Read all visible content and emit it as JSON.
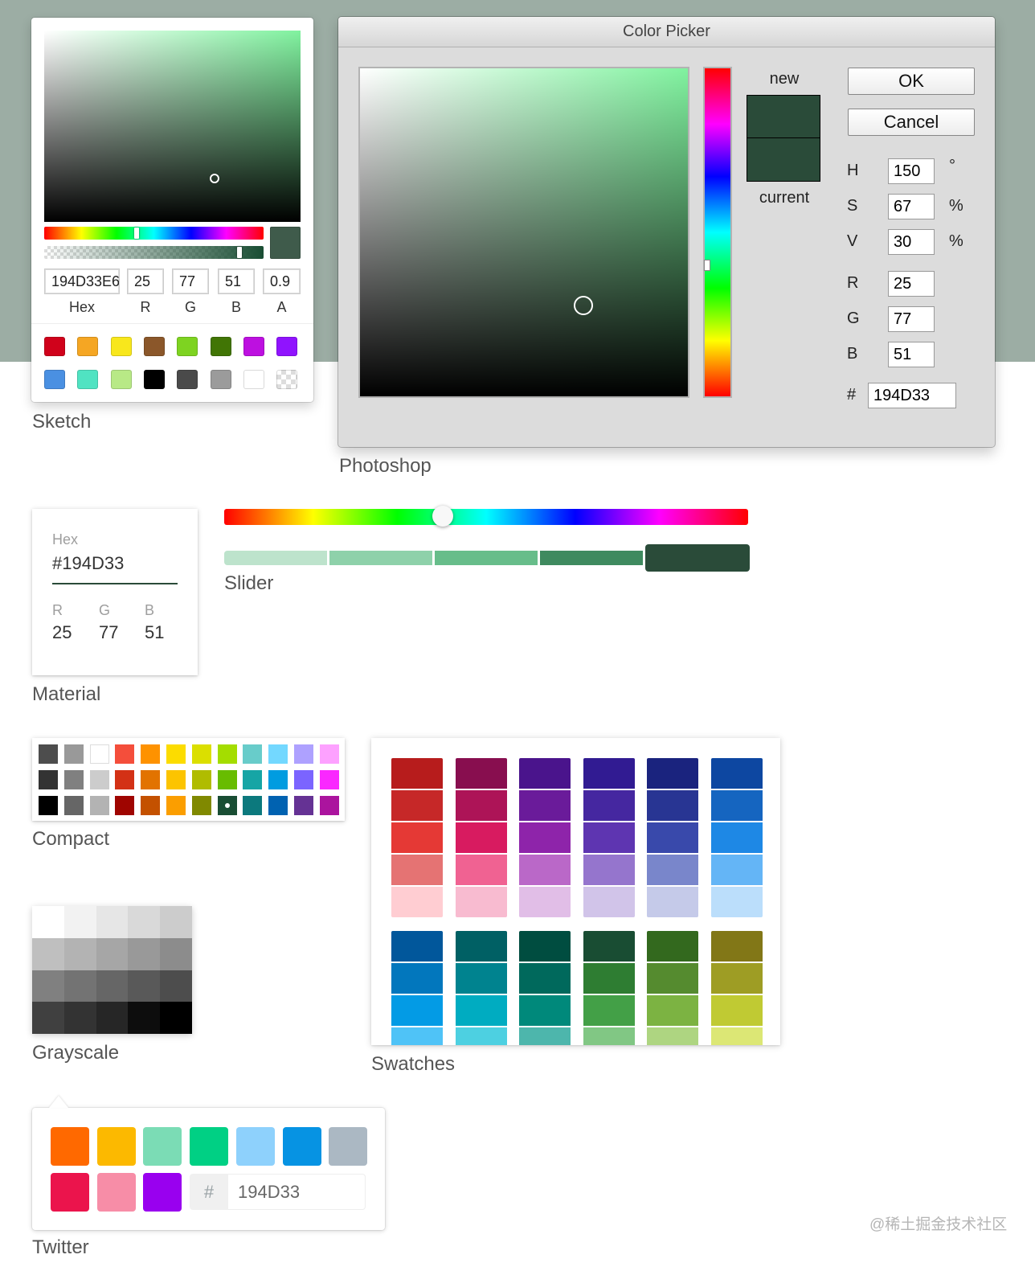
{
  "captions": {
    "sketch": "Sketch",
    "photoshop": "Photoshop",
    "slider": "Slider",
    "material": "Material",
    "compact": "Compact",
    "grayscale": "Grayscale",
    "swatches": "Swatches",
    "twitter": "Twitter"
  },
  "sketch": {
    "hex": "194D33E6",
    "r": "25",
    "g": "77",
    "b": "51",
    "a": "0.9",
    "labels": {
      "hex": "Hex",
      "r": "R",
      "g": "G",
      "b": "B",
      "a": "A"
    },
    "preview_color": "#3f5b4b",
    "presets": [
      "#D0021B",
      "#F5A623",
      "#F8E71C",
      "#8B572A",
      "#7ED321",
      "#417505",
      "#BD10E0",
      "#9013FE",
      "#4A90E2",
      "#50E3C2",
      "#B8E986",
      "#000000",
      "#4A4A4A",
      "#9B9B9B",
      "#FFFFFF",
      "transparent"
    ]
  },
  "photoshop": {
    "title": "Color Picker",
    "new_label": "new",
    "current_label": "current",
    "new_color": "#2a4b39",
    "current_color": "#2a4b39",
    "ok": "OK",
    "cancel": "Cancel",
    "fields": {
      "h": {
        "label": "H",
        "value": "150",
        "unit": "°"
      },
      "s": {
        "label": "S",
        "value": "67",
        "unit": "%"
      },
      "v": {
        "label": "V",
        "value": "30",
        "unit": "%"
      },
      "r": {
        "label": "R",
        "value": "25"
      },
      "g": {
        "label": "G",
        "value": "77"
      },
      "b": {
        "label": "B",
        "value": "51"
      },
      "hex": {
        "label": "#",
        "value": "194D33"
      }
    }
  },
  "material": {
    "hex_label": "Hex",
    "hex_value": "#194D33",
    "r_label": "R",
    "g_label": "G",
    "b_label": "B",
    "r": "25",
    "g": "77",
    "b": "51"
  },
  "slider": {
    "hue": 150,
    "swatches": [
      "#bde3cc",
      "#8ed1aa",
      "#67bd8a",
      "#3f8a5f",
      "#2a4b39"
    ],
    "selected_index": 4
  },
  "compact": {
    "colors": [
      [
        "#4D4D4D",
        "#999999",
        "#FFFFFF",
        "#F44E3B",
        "#FE9200",
        "#FCDC00",
        "#DBDF00",
        "#A4DD00",
        "#68CCCA",
        "#73D8FF",
        "#AEA1FF",
        "#FDA1FF"
      ],
      [
        "#333333",
        "#808080",
        "#CCCCCC",
        "#D33115",
        "#E27300",
        "#FCC400",
        "#B0BC00",
        "#68BC00",
        "#16A5A5",
        "#009CE0",
        "#7B64FF",
        "#FA28FF"
      ],
      [
        "#000000",
        "#666666",
        "#B3B3B3",
        "#9F0500",
        "#C45100",
        "#FB9E00",
        "#808900",
        "#194D33",
        "#0C797D",
        "#0062B1",
        "#653294",
        "#AB149E"
      ]
    ],
    "selected": "#194D33"
  },
  "grayscale": {
    "colors": [
      [
        "#FFFFFF",
        "#F2F2F2",
        "#E6E6E6",
        "#D9D9D9",
        "#CCCCCC"
      ],
      [
        "#BFBFBF",
        "#B3B3B3",
        "#A6A6A6",
        "#999999",
        "#8C8C8C"
      ],
      [
        "#808080",
        "#737373",
        "#666666",
        "#595959",
        "#4D4D4D"
      ],
      [
        "#404040",
        "#333333",
        "#262626",
        "#0D0D0D",
        "#000000"
      ]
    ]
  },
  "swatches": {
    "groups_top": [
      [
        "#B71C1C",
        "#C62828",
        "#E53935",
        "#E57373",
        "#FFCDD2"
      ],
      [
        "#880E4F",
        "#AD1457",
        "#D81B60",
        "#F06292",
        "#F8BBD0"
      ],
      [
        "#4A148C",
        "#6A1B9A",
        "#8E24AA",
        "#BA68C8",
        "#E1BEE7"
      ],
      [
        "#311B92",
        "#4527A0",
        "#5E35B1",
        "#9575CD",
        "#D1C4E9"
      ],
      [
        "#1A237E",
        "#283593",
        "#3949AB",
        "#7986CB",
        "#C5CAE9"
      ],
      [
        "#0D47A1",
        "#1565C0",
        "#1E88E5",
        "#64B5F6",
        "#BBDEFB"
      ]
    ],
    "groups_bottom": [
      [
        "#01579B",
        "#0277BD",
        "#039BE5",
        "#4FC3F7"
      ],
      [
        "#006064",
        "#00838F",
        "#00ACC1",
        "#4DD0E1"
      ],
      [
        "#004D40",
        "#00695C",
        "#00897B",
        "#4DB6AC"
      ],
      [
        "#194D33",
        "#2E7D32",
        "#43A047",
        "#81C784"
      ],
      [
        "#33691E",
        "#558B2F",
        "#7CB342",
        "#AED581"
      ],
      [
        "#827717",
        "#9E9D24",
        "#C0CA33",
        "#DCE775"
      ]
    ]
  },
  "twitter": {
    "colors": [
      "#FF6900",
      "#FCB900",
      "#7BDCB5",
      "#00D084",
      "#8ED1FC",
      "#0693E3",
      "#ABB8C3",
      "#EB144C",
      "#F78DA7",
      "#9900EF"
    ],
    "hash": "#",
    "hex": "194D33"
  },
  "watermark": "@稀土掘金技术社区"
}
